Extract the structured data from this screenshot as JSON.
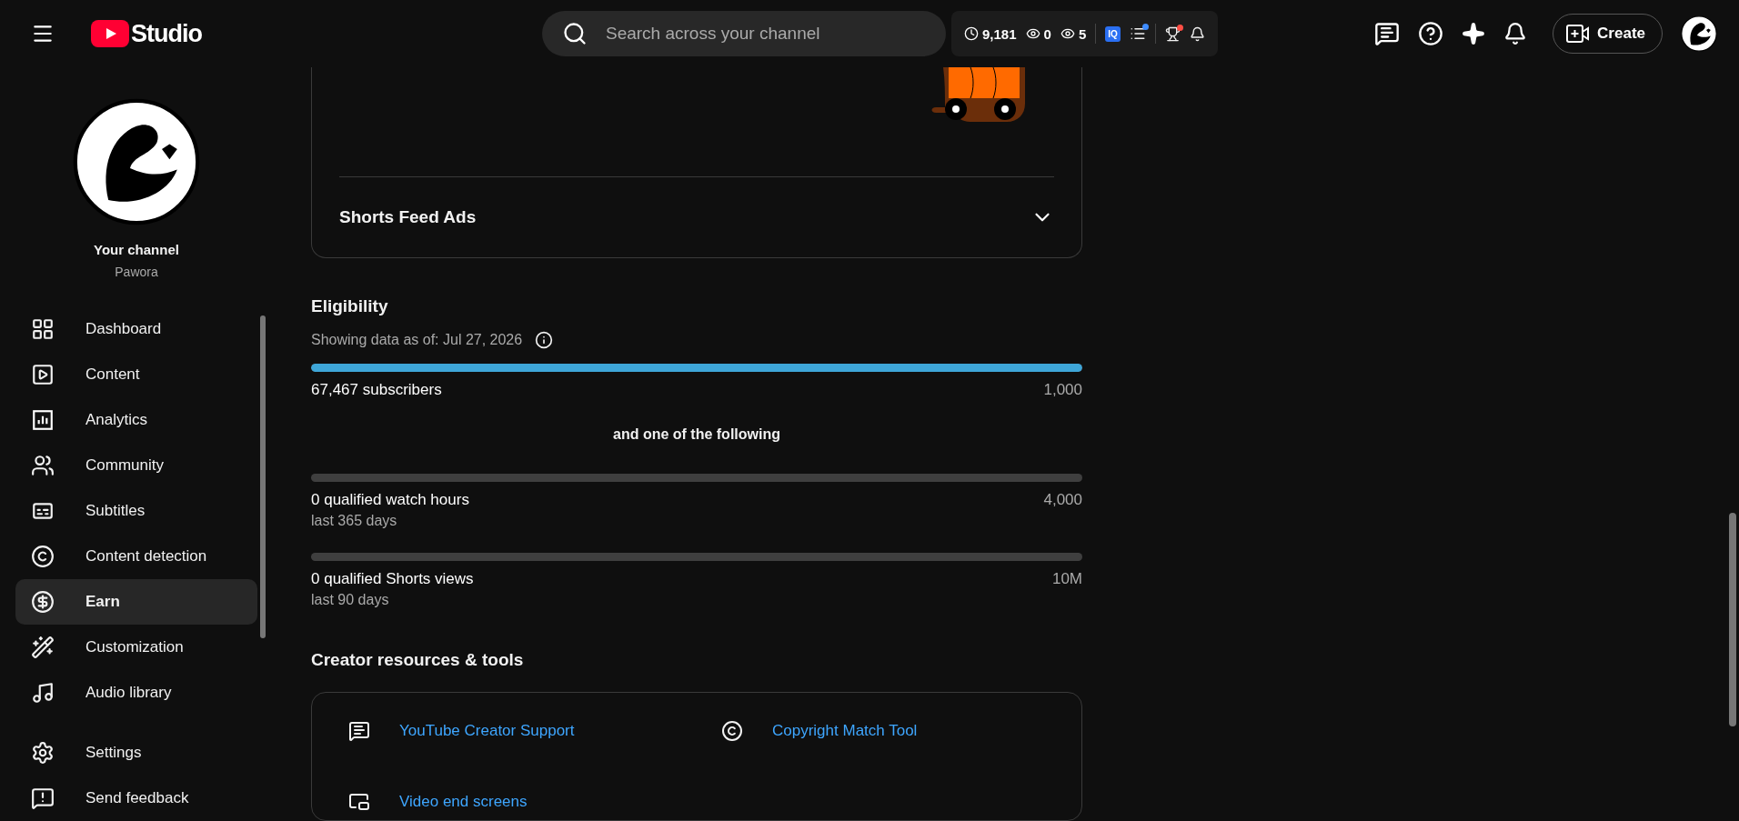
{
  "header": {
    "brand": "Studio",
    "search": {
      "placeholder": "Search across your channel"
    },
    "stats": [
      "9,181",
      "0",
      "5"
    ],
    "extension_badge": "IQ",
    "list_notification": true,
    "trophy_notification": true,
    "create_label": "Create"
  },
  "sidebar": {
    "channel_label": "Your channel",
    "channel_name": "Pawora",
    "items": [
      {
        "label": "Dashboard",
        "selected": false
      },
      {
        "label": "Content",
        "selected": false
      },
      {
        "label": "Analytics",
        "selected": false
      },
      {
        "label": "Community",
        "selected": false
      },
      {
        "label": "Subtitles",
        "selected": false
      },
      {
        "label": "Content detection",
        "selected": false
      },
      {
        "label": "Earn",
        "selected": true
      },
      {
        "label": "Customization",
        "selected": false
      },
      {
        "label": "Audio library",
        "selected": false
      }
    ],
    "footer_items": [
      "Settings",
      "Send feedback"
    ]
  },
  "ads_card": {
    "section": {
      "title": "Shorts Feed Ads",
      "expanded": false
    }
  },
  "eligibility": {
    "title": "Eligibility",
    "as_of": "Showing data as of: Jul 27, 2026",
    "requirements": [
      {
        "label": "67,467 subscribers",
        "target": "1,000",
        "level": 1
      },
      {
        "connector": "and one of the following"
      },
      {
        "label": "0 qualified watch hours",
        "period": "last 365 days",
        "target": "4,000",
        "level": 0
      },
      {
        "label": "0 qualified Shorts views",
        "period": "last 90 days",
        "target": "10M",
        "level": 0
      }
    ]
  },
  "resources": {
    "title": "Creator resources & tools",
    "links": [
      "YouTube Creator Support",
      "Copyright Match Tool",
      "Video end screens"
    ]
  }
}
